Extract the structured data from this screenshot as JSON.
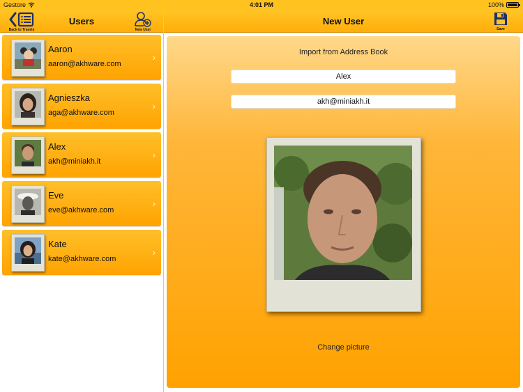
{
  "status_bar": {
    "carrier": "Gestore",
    "time": "4:01 PM",
    "battery": "100%"
  },
  "left_nav": {
    "back_label": "Back to Travels",
    "title": "Users",
    "new_user_label": "New User"
  },
  "right_nav": {
    "title": "New User",
    "save_label": "Save"
  },
  "users": [
    {
      "name": "Aaron",
      "email": "aaron@akhware.com"
    },
    {
      "name": "Agnieszka",
      "email": "aga@akhware.com"
    },
    {
      "name": "Alex",
      "email": "akh@miniakh.it"
    },
    {
      "name": "Eve",
      "email": "eve@akhware.com"
    },
    {
      "name": "Kate",
      "email": "kate@akhware.com"
    }
  ],
  "detail": {
    "import_link": "Import from Address Book",
    "name_value": "Alex",
    "email_value": "akh@miniakh.it",
    "change_picture": "Change picture"
  },
  "colors": {
    "accent": "#ffa300",
    "nav": "#ffc21f"
  }
}
